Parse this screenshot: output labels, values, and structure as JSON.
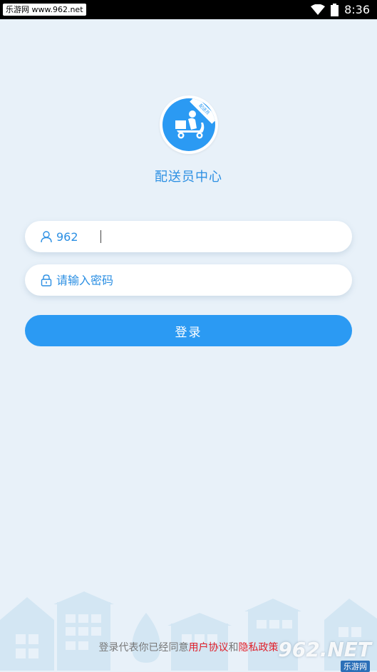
{
  "status_bar": {
    "watermark": "乐游网 www.962.net",
    "time": "8:36"
  },
  "app": {
    "title": "配送员中心",
    "logo_ribbon": "配送员"
  },
  "form": {
    "username_value": "962",
    "password_placeholder": "请输入密码",
    "login_label": "登录"
  },
  "agreement": {
    "prefix": "登录代表你已经同意",
    "user_agreement": "用户协议",
    "and": "和",
    "privacy_policy": "隐私政策"
  },
  "brand": {
    "big": "962.NET",
    "small": "乐游网"
  },
  "colors": {
    "accent": "#2b9af3",
    "background": "#e8f1f9",
    "link_red": "#e0202a"
  }
}
